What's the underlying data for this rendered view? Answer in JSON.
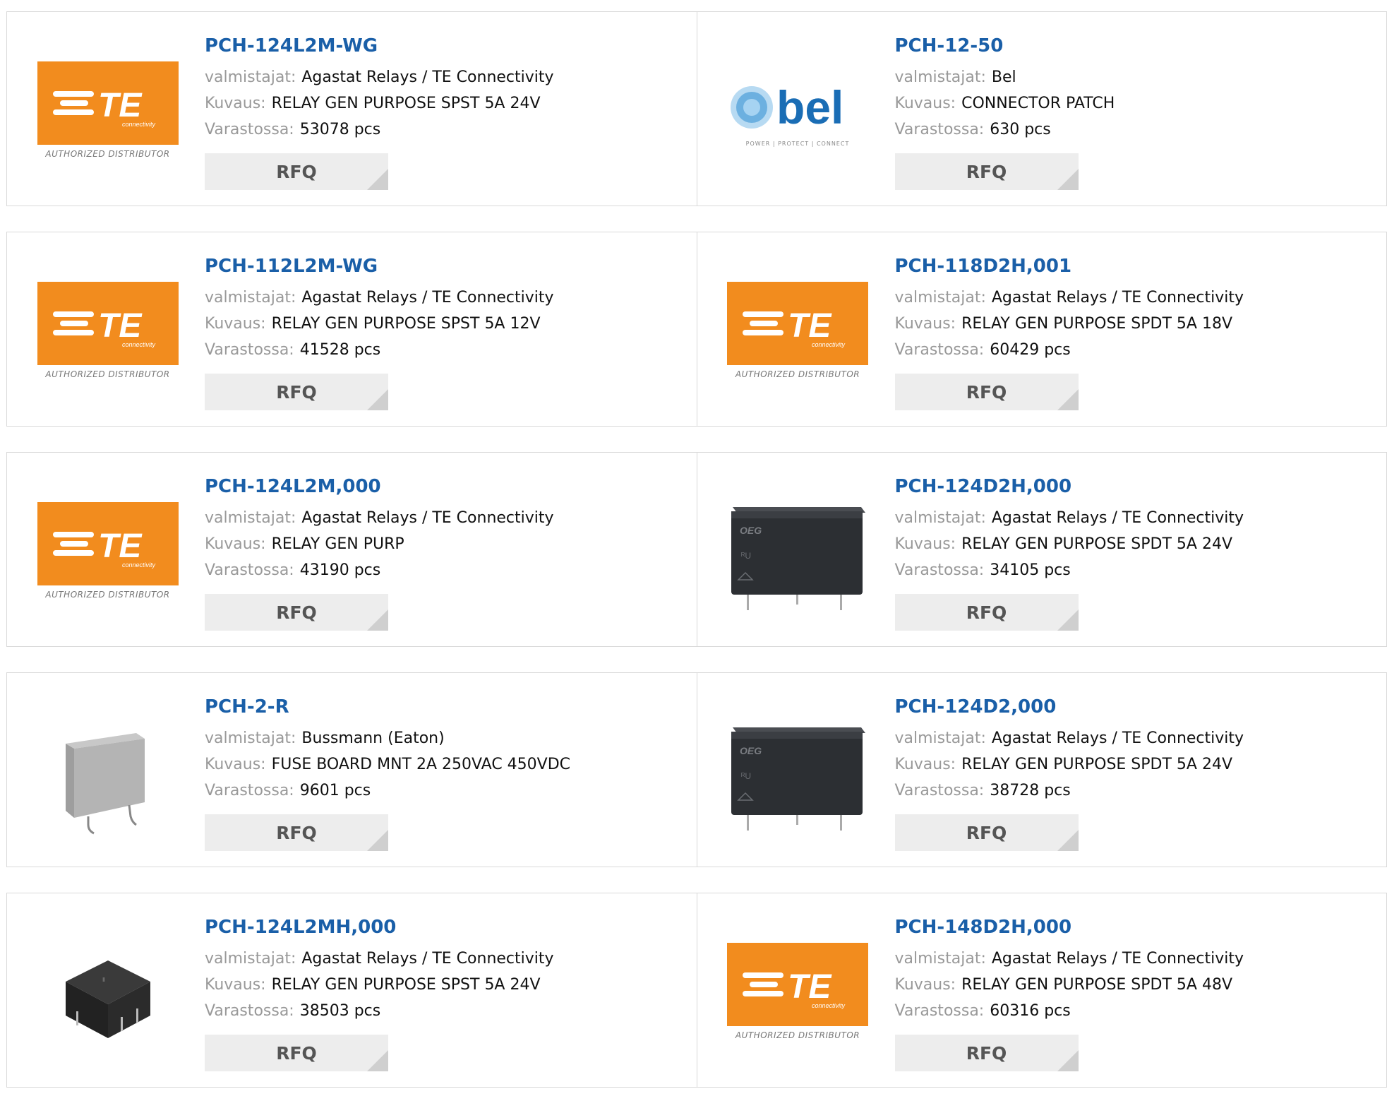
{
  "labels": {
    "manufacturer": "valmistajat:",
    "description": "Kuvaus:",
    "stock": "Varastossa:",
    "rfq": "RFQ"
  },
  "logos": {
    "te_text": "TE",
    "te_sub": "connectivity",
    "te_distributor": "AUTHORIZED DISTRIBUTOR",
    "bel_text": "bel",
    "bel_tag": "POWER | PROTECT | CONNECT",
    "relay_brand": "OEG"
  },
  "colors": {
    "link": "#1a5fa8",
    "te_orange": "#f28c1e",
    "bel_blue": "#1a6db5",
    "rfq_bg": "#ededed"
  },
  "products": [
    {
      "part": "PCH-124L2M-WG",
      "manufacturer": "Agastat Relays / TE Connectivity",
      "description": "RELAY GEN PURPOSE SPST 5A 24V",
      "stock": "53078 pcs",
      "image": "te-logo"
    },
    {
      "part": "PCH-12-50",
      "manufacturer": "Bel",
      "description": "CONNECTOR PATCH",
      "stock": "630 pcs",
      "image": "bel-logo"
    },
    {
      "part": "PCH-112L2M-WG",
      "manufacturer": "Agastat Relays / TE Connectivity",
      "description": "RELAY GEN PURPOSE SPST 5A 12V",
      "stock": "41528 pcs",
      "image": "te-logo"
    },
    {
      "part": "PCH-118D2H,001",
      "manufacturer": "Agastat Relays / TE Connectivity",
      "description": "RELAY GEN PURPOSE SPDT 5A 18V",
      "stock": "60429 pcs",
      "image": "te-logo"
    },
    {
      "part": "PCH-124L2M,000",
      "manufacturer": "Agastat Relays / TE Connectivity",
      "description": "RELAY GEN PURP",
      "stock": "43190 pcs",
      "image": "te-logo"
    },
    {
      "part": "PCH-124D2H,000",
      "manufacturer": "Agastat Relays / TE Connectivity",
      "description": "RELAY GEN PURPOSE SPDT 5A 24V",
      "stock": "34105 pcs",
      "image": "relay-photo"
    },
    {
      "part": "PCH-2-R",
      "manufacturer": "Bussmann (Eaton)",
      "description": "FUSE BOARD MNT 2A 250VAC 450VDC",
      "stock": "9601 pcs",
      "image": "fuse-photo"
    },
    {
      "part": "PCH-124D2,000",
      "manufacturer": "Agastat Relays / TE Connectivity",
      "description": "RELAY GEN PURPOSE SPDT 5A 24V",
      "stock": "38728 pcs",
      "image": "relay-photo"
    },
    {
      "part": "PCH-124L2MH,000",
      "manufacturer": "Agastat Relays / TE Connectivity",
      "description": "RELAY GEN PURPOSE SPST 5A 24V",
      "stock": "38503 pcs",
      "image": "small-relay-photo"
    },
    {
      "part": "PCH-148D2H,000",
      "manufacturer": "Agastat Relays / TE Connectivity",
      "description": "RELAY GEN PURPOSE SPDT 5A 48V",
      "stock": "60316 pcs",
      "image": "te-logo"
    }
  ]
}
